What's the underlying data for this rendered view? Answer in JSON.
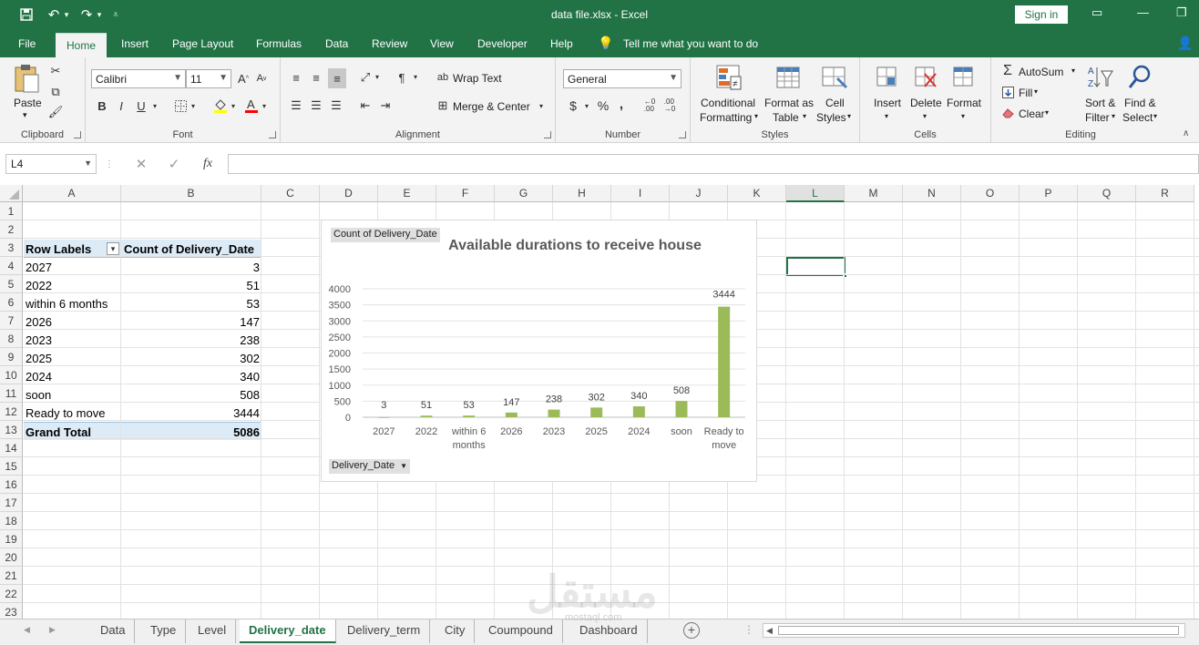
{
  "window": {
    "title": "data file.xlsx  -  Excel",
    "signin_label": "Sign in"
  },
  "ribbon_tabs": [
    "File",
    "Home",
    "Insert",
    "Page Layout",
    "Formulas",
    "Data",
    "Review",
    "View",
    "Developer",
    "Help"
  ],
  "tell_me": "Tell me what you want to do",
  "ribbon": {
    "clipboard": {
      "paste": "Paste",
      "label": "Clipboard"
    },
    "font": {
      "name": "Calibri",
      "size": "11",
      "bold": "B",
      "italic": "I",
      "underline": "U",
      "label": "Font"
    },
    "alignment": {
      "wrap": "Wrap Text",
      "merge": "Merge & Center",
      "label": "Alignment"
    },
    "number": {
      "format": "General",
      "currency": "$",
      "percent": "%",
      "comma": ",",
      "label": "Number"
    },
    "styles": {
      "conditional_1": "Conditional",
      "conditional_2": "Formatting",
      "format_as_1": "Format as",
      "format_as_2": "Table",
      "cell_styles_1": "Cell",
      "cell_styles_2": "Styles",
      "label": "Styles"
    },
    "cells": {
      "insert": "Insert",
      "delete": "Delete",
      "format": "Format",
      "label": "Cells"
    },
    "editing": {
      "autosum": "AutoSum",
      "fill": "Fill",
      "clear": "Clear",
      "sort_1": "Sort &",
      "sort_2": "Filter",
      "find_1": "Find &",
      "find_2": "Select",
      "label": "Editing"
    }
  },
  "formula_bar": {
    "name_box": "L4",
    "fx": "fx",
    "value": ""
  },
  "columns": [
    "A",
    "B",
    "C",
    "D",
    "E",
    "F",
    "G",
    "H",
    "I",
    "J",
    "K",
    "L",
    "M",
    "N",
    "O",
    "P",
    "Q",
    "R"
  ],
  "rows": [
    "1",
    "2",
    "3",
    "4",
    "5",
    "6",
    "7",
    "8",
    "9",
    "10",
    "11",
    "12",
    "13",
    "14",
    "15",
    "16",
    "17",
    "18",
    "19",
    "20",
    "21",
    "22",
    "23"
  ],
  "pivot": {
    "header_row_labels": "Row Labels",
    "header_count": "Count of Delivery_Date",
    "rows": [
      {
        "label": "2027",
        "value": "3"
      },
      {
        "label": "2022",
        "value": "51"
      },
      {
        "label": "within 6 months",
        "value": "53"
      },
      {
        "label": "2026",
        "value": "147"
      },
      {
        "label": "2023",
        "value": "238"
      },
      {
        "label": "2025",
        "value": "302"
      },
      {
        "label": "2024",
        "value": "340"
      },
      {
        "label": "soon",
        "value": "508"
      },
      {
        "label": "Ready to move",
        "value": "3444"
      }
    ],
    "grand_total_label": "Grand Total",
    "grand_total_value": "5086"
  },
  "chart_data": {
    "type": "bar",
    "title": "Available durations to receive house",
    "field_button_value": "Count of Delivery_Date",
    "field_button_axis": "Delivery_Date",
    "categories": [
      "2027",
      "2022",
      "within 6 months",
      "2026",
      "2023",
      "2025",
      "2024",
      "soon",
      "Ready to move"
    ],
    "values": [
      3,
      51,
      53,
      147,
      238,
      302,
      340,
      508,
      3444
    ],
    "ylim": [
      0,
      4000
    ],
    "yticks": [
      0,
      500,
      1000,
      1500,
      2000,
      2500,
      3000,
      3500,
      4000
    ],
    "grid": true,
    "legend": "none",
    "bar_color": "#9BBB59"
  },
  "sheet_tabs": [
    "Data",
    "Type",
    "Level",
    "Delivery_date",
    "Delivery_term",
    "City",
    "Coumpound",
    "Dashboard"
  ],
  "active_sheet": "Delivery_date",
  "watermark": {
    "text": "مستقل",
    "sub": "mostaql.com"
  },
  "colors": {
    "accent": "#217346",
    "pivot_header": "#DDEBF7"
  }
}
